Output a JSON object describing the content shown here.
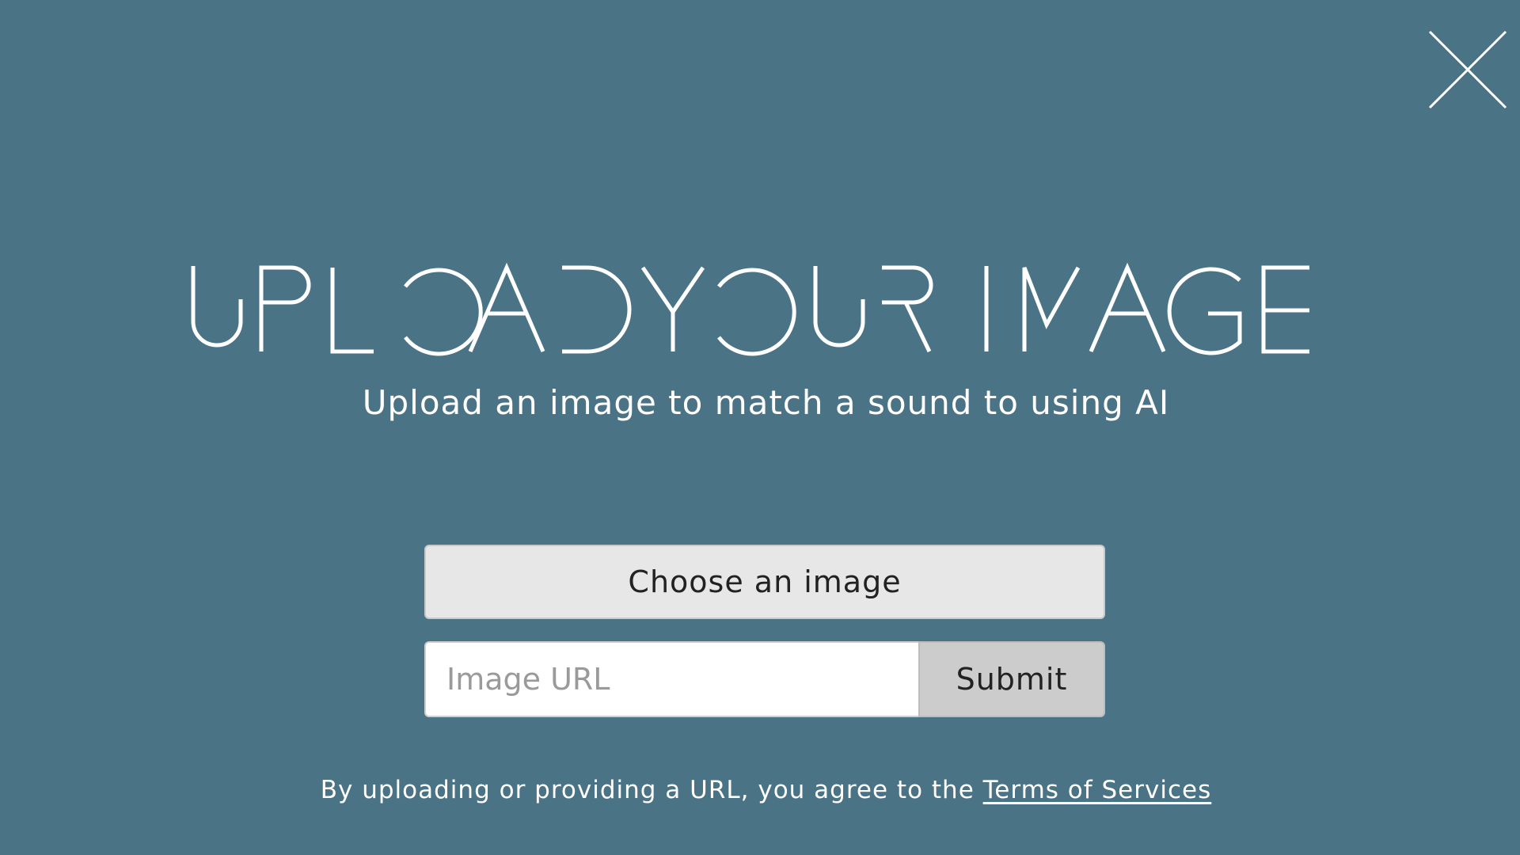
{
  "close": {
    "icon": "close-icon"
  },
  "header": {
    "title": "UPLOAD YOUR IMAGE",
    "subtitle": "Upload an image to match a sound to using AI"
  },
  "upload": {
    "choose_label": "Choose an image",
    "url_placeholder": "Image URL",
    "url_value": "",
    "submit_label": "Submit"
  },
  "footer": {
    "terms_prefix": "By uploading or providing a URL, you agree to the ",
    "terms_link": "Terms of Services"
  },
  "colors": {
    "background": "#4a7386",
    "text": "#ffffff",
    "choose_button": "#e7e7e7",
    "submit_button": "#cccccc"
  }
}
